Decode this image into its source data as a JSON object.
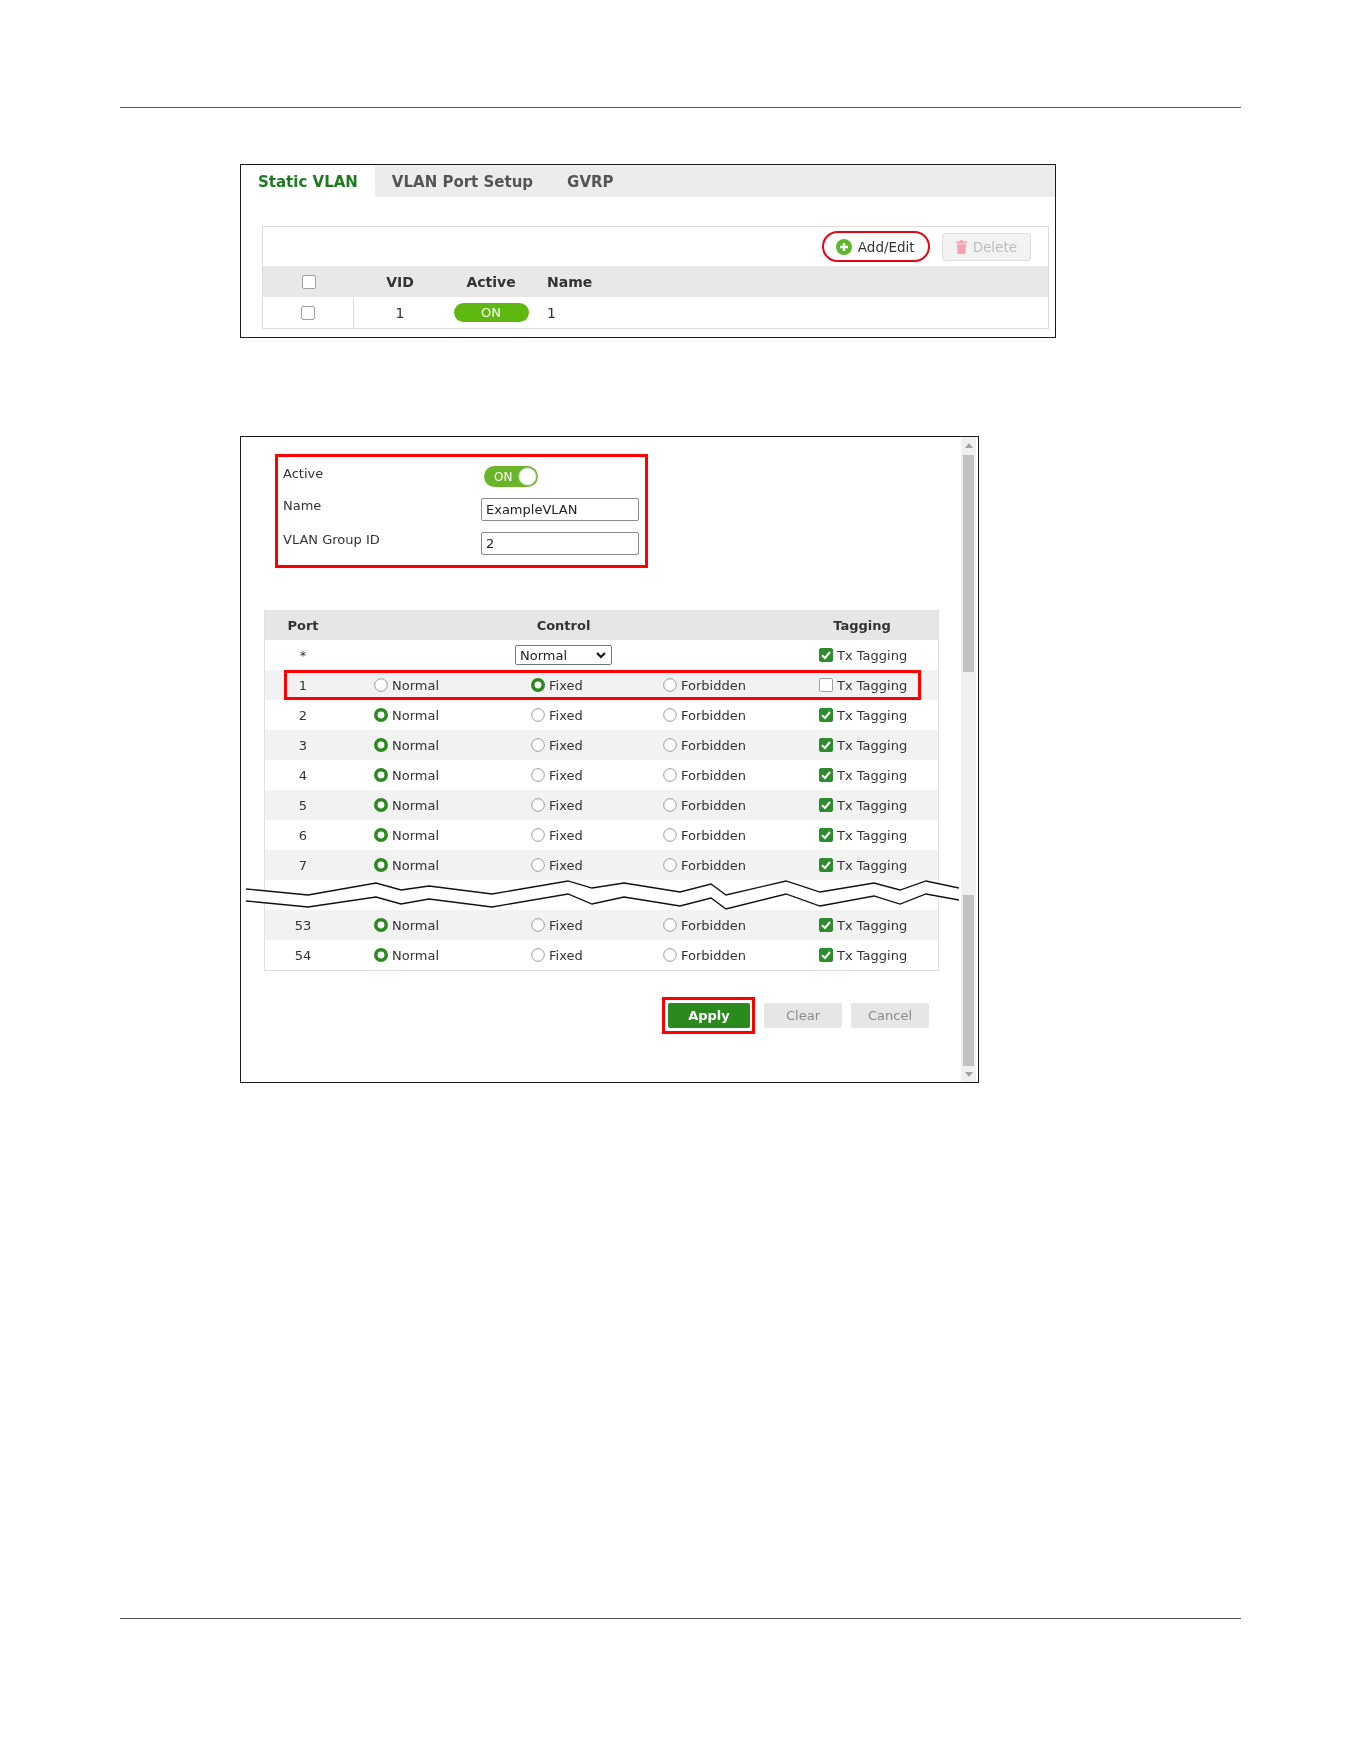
{
  "tab_panel": {
    "tabs": [
      {
        "label": "Static VLAN",
        "selected": true
      },
      {
        "label": "VLAN Port Setup",
        "selected": false
      },
      {
        "label": "GVRP",
        "selected": false
      }
    ],
    "toolbar": [
      {
        "kind": "add_edit",
        "label": "Add/Edit",
        "disabled": false,
        "highlighted": true
      },
      {
        "kind": "delete",
        "label": "Delete",
        "disabled": true,
        "highlighted": false
      }
    ],
    "table": {
      "select_all_checked": false,
      "columns": [
        "VID",
        "Active",
        "Name"
      ],
      "rows": [
        {
          "checked": false,
          "vid": "1",
          "active": {
            "label": "ON",
            "on": true
          },
          "name": "1"
        }
      ]
    }
  },
  "edit_window": {
    "settings": {
      "highlighted": true,
      "fields": [
        {
          "kind": "toggle",
          "label": "Active",
          "value": "ON",
          "on": true
        },
        {
          "kind": "text",
          "label": "Name",
          "value": "ExampleVLAN"
        },
        {
          "kind": "text",
          "label": "VLAN Group ID",
          "value": "2"
        }
      ]
    },
    "port_table": {
      "columns": [
        "Port",
        "Control",
        "Tagging"
      ],
      "all_row": {
        "port": "*",
        "control_value": "Normal",
        "tagging": {
          "label": "Tx Tagging",
          "checked": true
        }
      },
      "rows": [
        {
          "kind": "port",
          "port": "1",
          "highlighted": true,
          "options": [
            {
              "label": "Normal",
              "selected": false
            },
            {
              "label": "Fixed",
              "selected": true
            },
            {
              "label": "Forbidden",
              "selected": false
            }
          ],
          "tagging": {
            "label": "Tx Tagging",
            "checked": false
          }
        },
        {
          "kind": "port",
          "port": "2",
          "highlighted": false,
          "options": [
            {
              "label": "Normal",
              "selected": true
            },
            {
              "label": "Fixed",
              "selected": false
            },
            {
              "label": "Forbidden",
              "selected": false
            }
          ],
          "tagging": {
            "label": "Tx Tagging",
            "checked": true
          }
        },
        {
          "kind": "port",
          "port": "3",
          "highlighted": false,
          "options": [
            {
              "label": "Normal",
              "selected": true
            },
            {
              "label": "Fixed",
              "selected": false
            },
            {
              "label": "Forbidden",
              "selected": false
            }
          ],
          "tagging": {
            "label": "Tx Tagging",
            "checked": true
          }
        },
        {
          "kind": "port",
          "port": "4",
          "highlighted": false,
          "options": [
            {
              "label": "Normal",
              "selected": true
            },
            {
              "label": "Fixed",
              "selected": false
            },
            {
              "label": "Forbidden",
              "selected": false
            }
          ],
          "tagging": {
            "label": "Tx Tagging",
            "checked": true
          }
        },
        {
          "kind": "port",
          "port": "5",
          "highlighted": false,
          "options": [
            {
              "label": "Normal",
              "selected": true
            },
            {
              "label": "Fixed",
              "selected": false
            },
            {
              "label": "Forbidden",
              "selected": false
            }
          ],
          "tagging": {
            "label": "Tx Tagging",
            "checked": true
          }
        },
        {
          "kind": "port",
          "port": "6",
          "highlighted": false,
          "options": [
            {
              "label": "Normal",
              "selected": true
            },
            {
              "label": "Fixed",
              "selected": false
            },
            {
              "label": "Forbidden",
              "selected": false
            }
          ],
          "tagging": {
            "label": "Tx Tagging",
            "checked": true
          }
        },
        {
          "kind": "port",
          "port": "7",
          "highlighted": false,
          "options": [
            {
              "label": "Normal",
              "selected": true
            },
            {
              "label": "Fixed",
              "selected": false
            },
            {
              "label": "Forbidden",
              "selected": false
            }
          ],
          "tagging": {
            "label": "Tx Tagging",
            "checked": true
          }
        },
        {
          "kind": "break"
        },
        {
          "kind": "port",
          "port": "53",
          "highlighted": false,
          "options": [
            {
              "label": "Normal",
              "selected": true
            },
            {
              "label": "Fixed",
              "selected": false
            },
            {
              "label": "Forbidden",
              "selected": false
            }
          ],
          "tagging": {
            "label": "Tx Tagging",
            "checked": true
          }
        },
        {
          "kind": "port",
          "port": "54",
          "highlighted": false,
          "options": [
            {
              "label": "Normal",
              "selected": true
            },
            {
              "label": "Fixed",
              "selected": false
            },
            {
              "label": "Forbidden",
              "selected": false
            }
          ],
          "tagging": {
            "label": "Tx Tagging",
            "checked": true
          }
        }
      ]
    },
    "buttons": [
      {
        "kind": "apply",
        "label": "Apply",
        "highlighted": true
      },
      {
        "kind": "clear",
        "label": "Clear",
        "highlighted": false
      },
      {
        "kind": "cancel",
        "label": "Cancel",
        "highlighted": false
      }
    ]
  }
}
